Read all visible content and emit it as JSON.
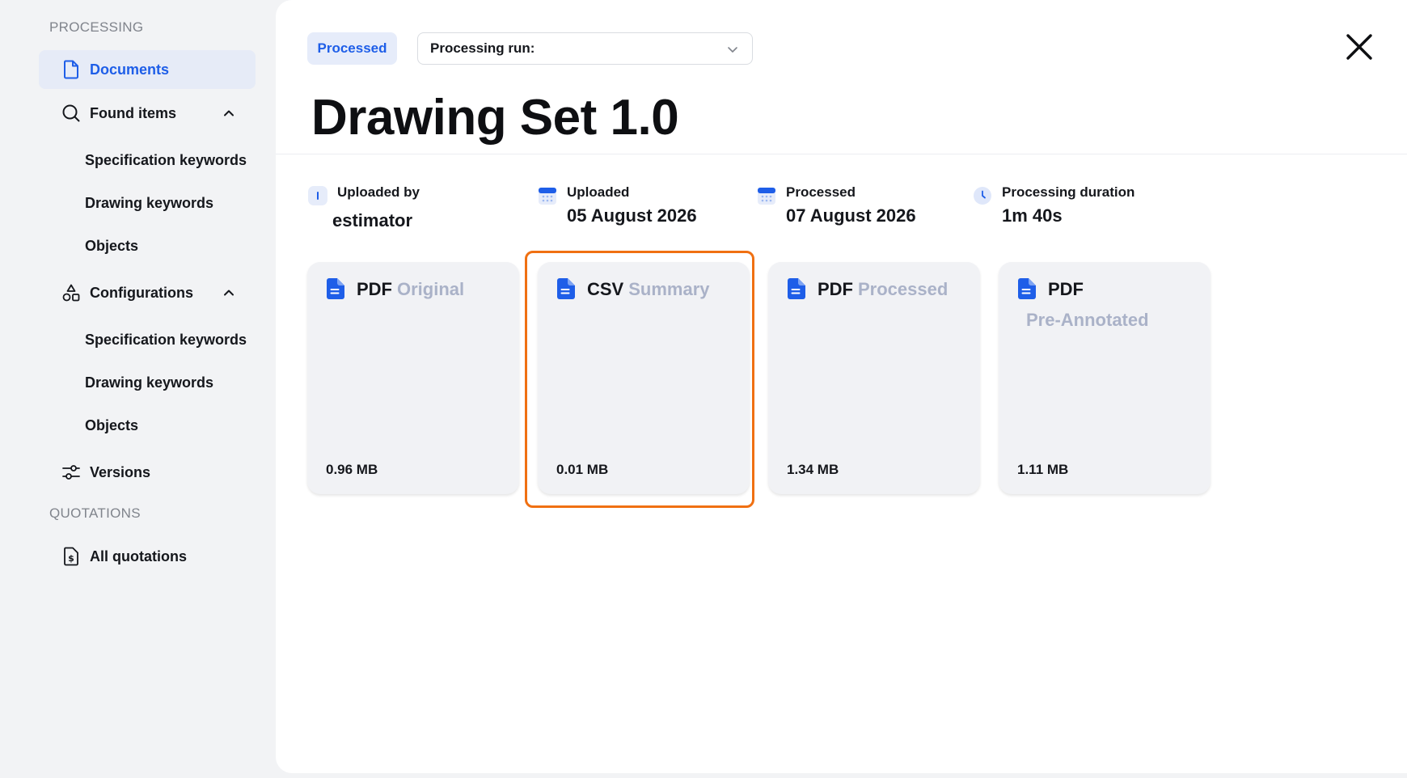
{
  "sidebar": {
    "processing_label": "PROCESSING",
    "documents": "Documents",
    "found_items": {
      "label": "Found items",
      "children": [
        "Specification keywords",
        "Drawing keywords",
        "Objects"
      ]
    },
    "configurations": {
      "label": "Configurations",
      "children": [
        "Specification keywords",
        "Drawing keywords",
        "Objects"
      ]
    },
    "versions": "Versions",
    "quotations_label": "QUOTATIONS",
    "all_quotations": "All quotations"
  },
  "header": {
    "status": "Processed",
    "run_select_label": "Processing run:",
    "title": "Drawing Set 1.0"
  },
  "meta": {
    "uploaded_by": {
      "label": "Uploaded by",
      "value": "estimator",
      "icon": "user-badge-icon"
    },
    "uploaded": {
      "label": "Uploaded",
      "value": "05 August 2026",
      "icon": "calendar-icon"
    },
    "processed": {
      "label": "Processed",
      "value": "07 August 2026",
      "icon": "calendar-icon"
    },
    "duration": {
      "label": "Processing duration",
      "value": "1m 40s",
      "icon": "clock-icon"
    }
  },
  "files": [
    {
      "type": "PDF",
      "kind": "Original",
      "size": "0.96 MB"
    },
    {
      "type": "CSV",
      "kind": "Summary",
      "size": "0.01 MB",
      "highlighted": true
    },
    {
      "type": "PDF",
      "kind": "Processed",
      "size": "1.34 MB"
    },
    {
      "type": "PDF",
      "kind": "Pre-Annotated",
      "size": "1.11 MB"
    }
  ],
  "colors": {
    "accent": "#1e5ee8",
    "highlight": "#f07012",
    "muted_kind": "#aab2c8",
    "sidebar_bg": "#f2f3f5",
    "card_bg": "#f1f2f5"
  }
}
